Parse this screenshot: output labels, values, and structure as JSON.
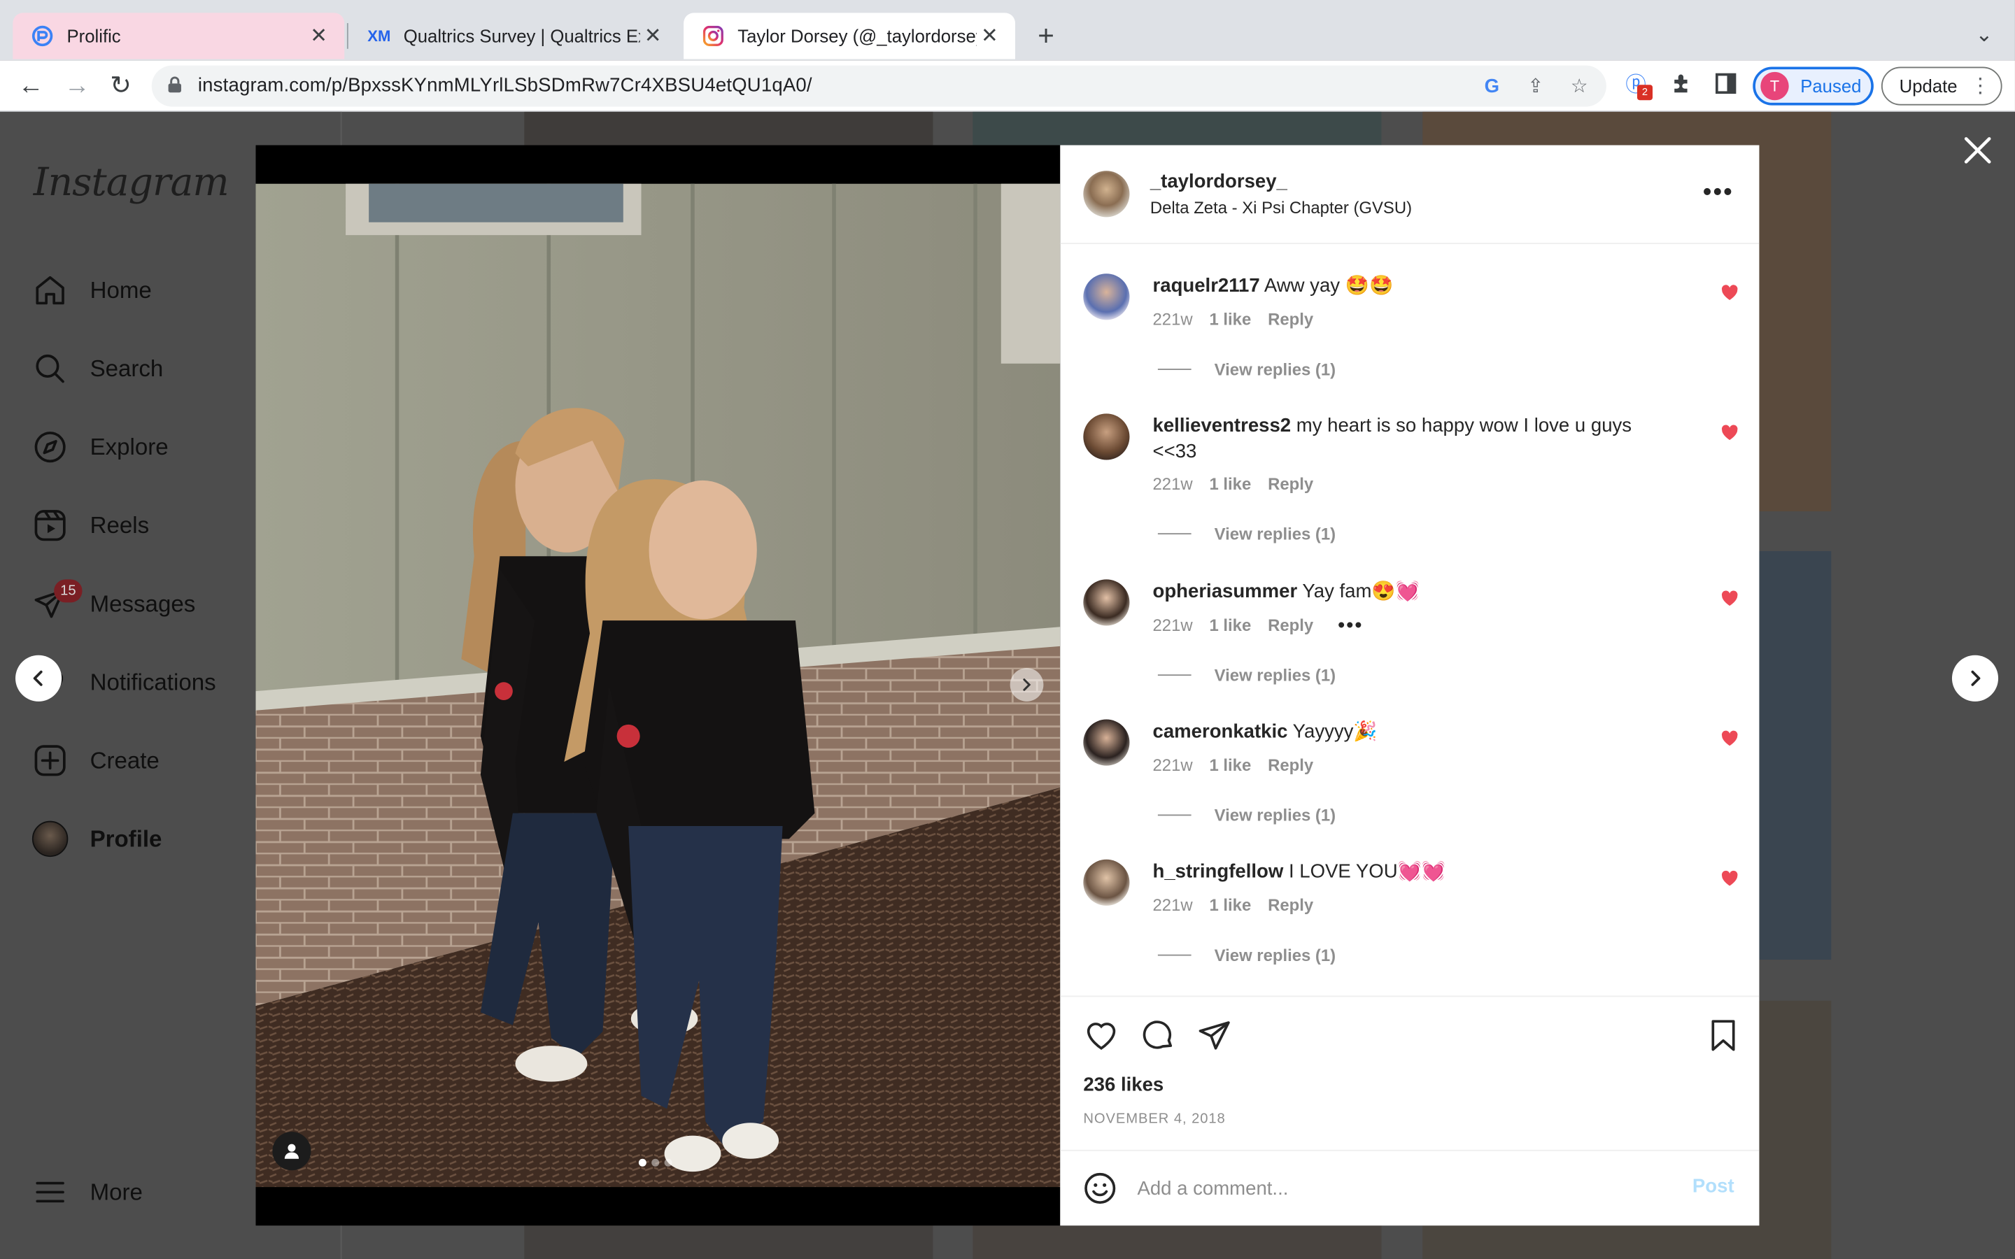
{
  "browser": {
    "tabs": [
      {
        "title": "Prolific",
        "icon": "prolific-icon"
      },
      {
        "title": "Qualtrics Survey | Qualtrics Exp",
        "icon": "qualtrics-icon"
      },
      {
        "title": "Taylor Dorsey (@_taylordorsey",
        "icon": "instagram-icon"
      }
    ],
    "active_tab": 2,
    "url": "instagram.com/p/BpxssKYnmMLYrlLSbSDmRw7Cr4XBSU4etQU1qA0/",
    "profile_initial": "T",
    "profile_status": "Paused",
    "update_label": "Update",
    "extension_badge": "2",
    "colors": {
      "profile": "#e8457a",
      "accent": "#1a73e8",
      "active_tab_tint": "#f9d7e3"
    }
  },
  "instagram": {
    "logo": "Instagram",
    "nav": [
      {
        "label": "Home",
        "icon": "home-icon"
      },
      {
        "label": "Search",
        "icon": "search-icon"
      },
      {
        "label": "Explore",
        "icon": "explore-compass-icon"
      },
      {
        "label": "Reels",
        "icon": "reels-icon"
      },
      {
        "label": "Messages",
        "icon": "messages-icon",
        "badge": "15"
      },
      {
        "label": "Notifications",
        "icon": "heart-icon"
      },
      {
        "label": "Create",
        "icon": "create-plus-icon"
      },
      {
        "label": "Profile",
        "icon": "profile-avatar"
      }
    ],
    "more_label": "More"
  },
  "post": {
    "username": "_taylordorsey_",
    "location": "Delta Zeta - Xi Psi Chapter (GVSU)",
    "likes": "236 likes",
    "date": "NOVEMBER 4, 2018",
    "comment_placeholder": "Add a comment...",
    "post_label": "Post",
    "carousel": {
      "count": 3,
      "current": 1
    },
    "comments": [
      {
        "user": "raquelr2117",
        "text": "Aww yay 🤩🤩",
        "age": "221w",
        "likes": "1 like",
        "reply": "Reply",
        "replies": "View replies (1)",
        "liked": true
      },
      {
        "user": "kellieventress2",
        "text": "my heart is so happy wow I love u guys <<33",
        "age": "221w",
        "likes": "1 like",
        "reply": "Reply",
        "replies": "View replies (1)",
        "liked": true
      },
      {
        "user": "opheriasummer",
        "text": "Yay fam😍💓",
        "age": "221w",
        "likes": "1 like",
        "reply": "Reply",
        "replies": "View replies (1)",
        "liked": true
      },
      {
        "user": "cameronkatkic",
        "text": "Yayyyy🎉",
        "age": "221w",
        "likes": "1 like",
        "reply": "Reply",
        "replies": "View replies (1)",
        "liked": true
      },
      {
        "user": "h_stringfellow",
        "text": "I LOVE YOU💓💓",
        "age": "221w",
        "likes": "1 like",
        "reply": "Reply",
        "replies": "View replies (1)",
        "liked": true
      }
    ],
    "colors": {
      "heart": "#ed4956",
      "post_button": "#b2dffc",
      "muted": "#8e8e8e"
    }
  }
}
